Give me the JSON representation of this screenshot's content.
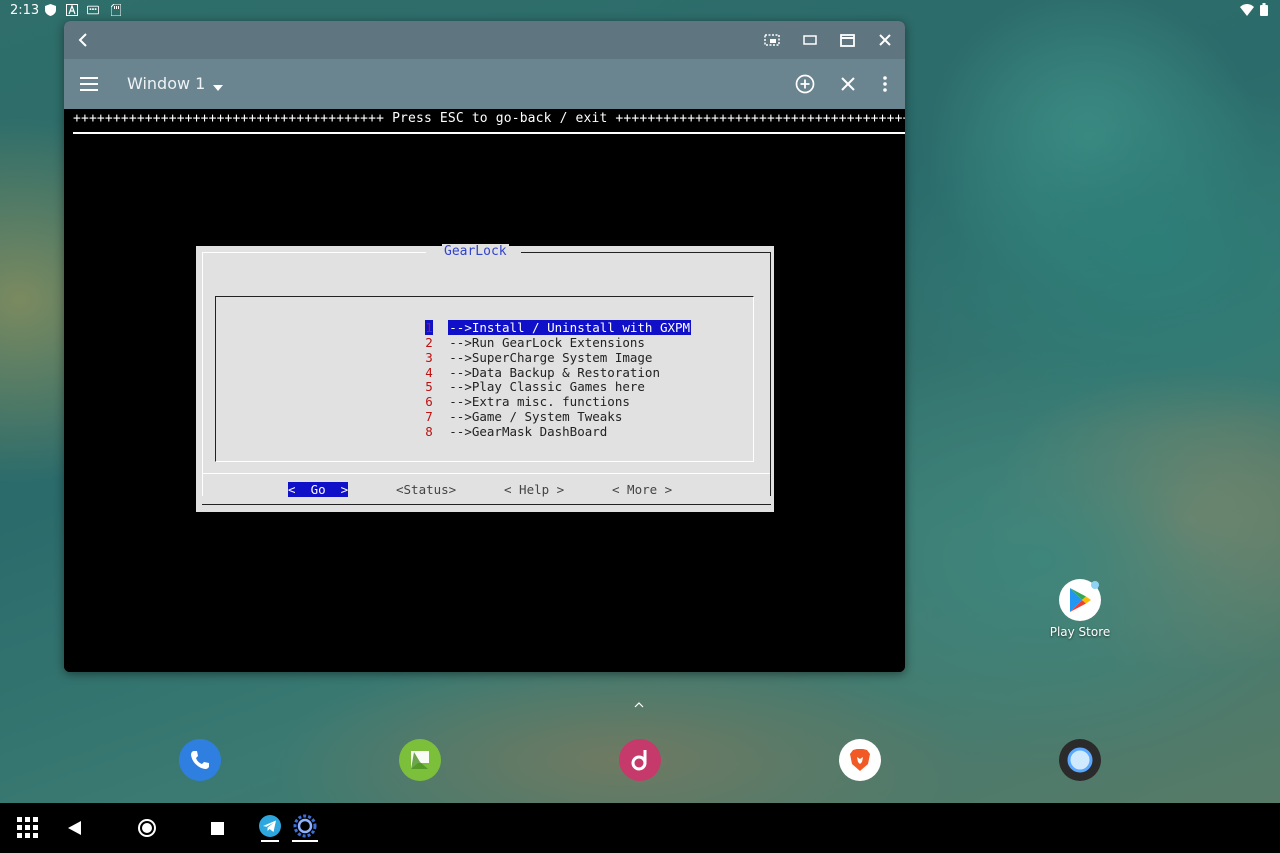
{
  "status_bar": {
    "time": "2:13"
  },
  "window": {
    "title": "Window 1"
  },
  "terminal": {
    "banner": "+++++++++++++++++++++++++++++++++++++++ Press ESC to go-back / exit ++++++++++++++++++++++++++++++++++++++"
  },
  "dialog": {
    "title": "GearLock",
    "items": [
      {
        "num": "1",
        "label": "-->Install / Uninstall with GXPM"
      },
      {
        "num": "2",
        "label": "-->Run GearLock Extensions"
      },
      {
        "num": "3",
        "label": "-->SuperCharge System Image"
      },
      {
        "num": "4",
        "label": "-->Data Backup & Restoration"
      },
      {
        "num": "5",
        "label": "-->Play Classic Games here"
      },
      {
        "num": "6",
        "label": "-->Extra misc. functions"
      },
      {
        "num": "7",
        "label": "-->Game / System Tweaks"
      },
      {
        "num": "8",
        "label": "-->GearMask DashBoard"
      }
    ],
    "buttons": {
      "go": "<  Go  >",
      "status": "<Status>",
      "help": "< Help >",
      "more": "< More >"
    }
  },
  "desktop": {
    "play_store_label": "Play Store"
  },
  "colors": {
    "titlebar": "#5f7580",
    "toolbar": "#6a8490",
    "selection": "#1010c8",
    "dialog_bg": "#e1e1e1",
    "menu_number": "#c01010"
  },
  "icons": {
    "titlebar": [
      "back-arrow-icon",
      "picture-in-picture-icon",
      "restore-window-icon",
      "maximize-window-icon",
      "close-icon"
    ],
    "toolbar": [
      "hamburger-menu-icon",
      "dropdown-icon",
      "add-circle-icon",
      "close-icon",
      "more-vert-icon"
    ],
    "dock": [
      "phone-icon",
      "messenger-icon",
      "music-icon",
      "brave-browser-icon",
      "circle-app-icon"
    ],
    "navbar": [
      "app-grid-icon",
      "back-icon",
      "home-icon",
      "recents-icon",
      "telegram-icon",
      "gearlock-icon"
    ]
  }
}
